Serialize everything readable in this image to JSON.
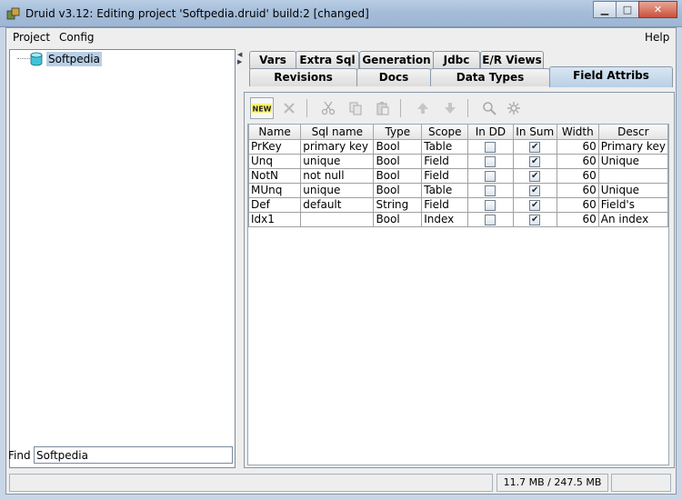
{
  "window": {
    "title": "Druid v3.12: Editing project 'Softpedia.druid' build:2 [changed]",
    "minimize_glyph": "▁",
    "maximize_glyph": "□",
    "close_glyph": "✕"
  },
  "menu": {
    "project": "Project",
    "config": "Config",
    "help": "Help"
  },
  "tree": {
    "root_label": "Softpedia",
    "root_icon": "database-icon"
  },
  "find": {
    "label": "Find",
    "value": "Softpedia"
  },
  "tabs": {
    "row1": [
      "Vars",
      "Extra Sql",
      "Generation",
      "Jdbc",
      "E/R Views"
    ],
    "row2": [
      "Revisions",
      "Docs",
      "Data Types",
      "Field Attribs"
    ],
    "selected": "Field Attribs"
  },
  "toolbar": {
    "new_label": "NEW",
    "icons": [
      "new-icon",
      "delete-icon",
      "cut-icon",
      "copy-icon",
      "paste-icon",
      "move-up-icon",
      "move-down-icon",
      "zoom-icon",
      "settings-icon"
    ]
  },
  "table": {
    "headers": [
      "Name",
      "Sql name",
      "Type",
      "Scope",
      "In DD",
      "In Sum",
      "Width",
      "Descr"
    ],
    "rows": [
      {
        "name": "PrKey",
        "sql": "primary key",
        "type": "Bool",
        "scope": "Table",
        "in_dd": false,
        "in_sum": true,
        "width": "60",
        "descr": "Primary key"
      },
      {
        "name": "Unq",
        "sql": "unique",
        "type": "Bool",
        "scope": "Field",
        "in_dd": false,
        "in_sum": true,
        "width": "60",
        "descr": "Unique"
      },
      {
        "name": "NotN",
        "sql": "not null",
        "type": "Bool",
        "scope": "Field",
        "in_dd": false,
        "in_sum": true,
        "width": "60",
        "descr": ""
      },
      {
        "name": "MUnq",
        "sql": "unique",
        "type": "Bool",
        "scope": "Table",
        "in_dd": false,
        "in_sum": true,
        "width": "60",
        "descr": "Unique"
      },
      {
        "name": "Def",
        "sql": "default",
        "type": "String",
        "scope": "Field",
        "in_dd": false,
        "in_sum": true,
        "width": "60",
        "descr": "Field's"
      },
      {
        "name": "Idx1",
        "sql": "",
        "type": "Bool",
        "scope": "Index",
        "in_dd": false,
        "in_sum": true,
        "width": "60",
        "descr": "An index"
      }
    ]
  },
  "status": {
    "memory": "11.7 MB / 247.5 MB"
  }
}
